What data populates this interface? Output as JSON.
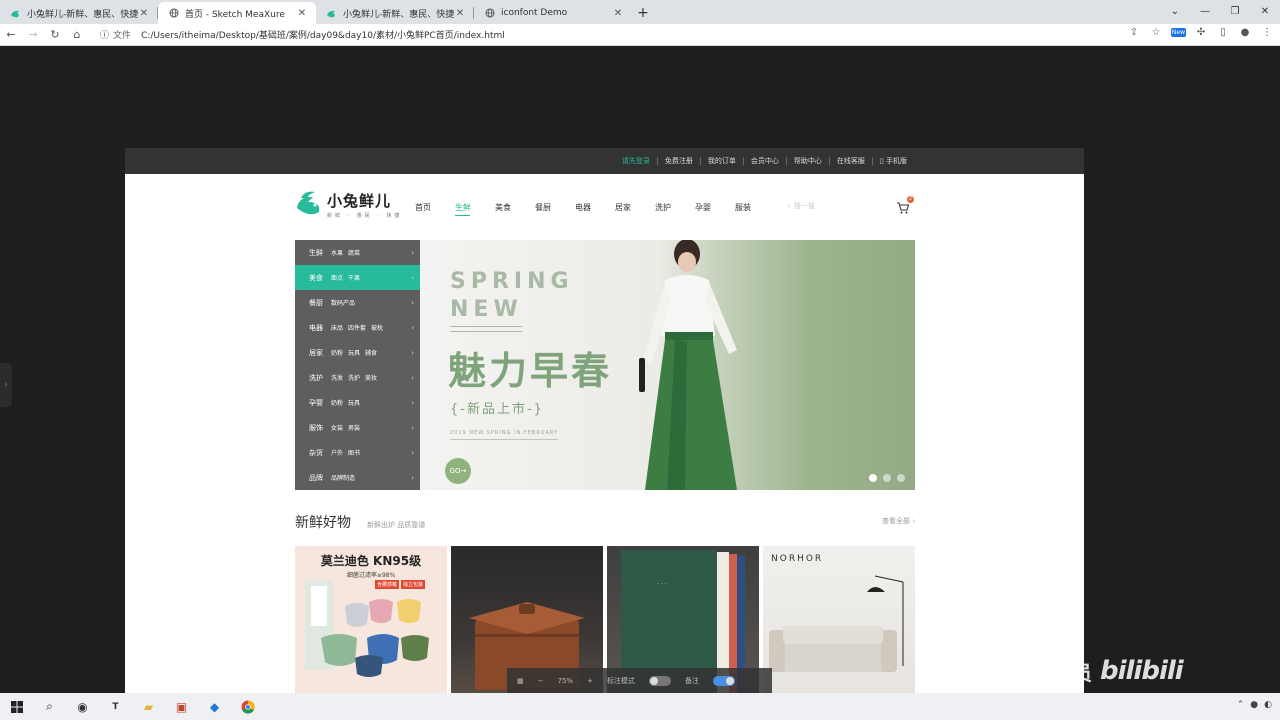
{
  "browser": {
    "tabs": [
      {
        "title": "小兔鲜儿-新鲜、惠民、快捷!",
        "favicon": "rabbit-logo-icon",
        "active": false
      },
      {
        "title": "首页 - Sketch MeaXure",
        "favicon": "globe-icon",
        "active": true
      },
      {
        "title": "小兔鲜儿-新鲜、惠民、快捷!",
        "favicon": "rabbit-logo-icon",
        "active": false
      },
      {
        "title": "iconfont Demo",
        "favicon": "globe-icon",
        "active": false
      }
    ],
    "address": {
      "protocol_label": "文件",
      "url": "C:/Users/itheima/Desktop/基础班/案例/day09&day10/素材/小兔鲜PC首页/index.html"
    },
    "new_badge": "New"
  },
  "site": {
    "topnav": [
      "请先登录",
      "免费注册",
      "我的订单",
      "会员中心",
      "帮助中心",
      "在线客服",
      "手机版"
    ],
    "logo": {
      "name": "小兔鲜儿",
      "sub": "新鲜 · 惠民 · 快捷"
    },
    "mainnav": [
      "首页",
      "生鲜",
      "美食",
      "餐厨",
      "电器",
      "居家",
      "洗护",
      "孕婴",
      "服装"
    ],
    "mainnav_active": 1,
    "search": {
      "placeholder": "搜一搜"
    },
    "cart": {
      "count": "2"
    },
    "categories": [
      {
        "name": "生鲜",
        "subs": [
          "水果",
          "蔬菜"
        ]
      },
      {
        "name": "美食",
        "subs": [
          "面点",
          "干果"
        ]
      },
      {
        "name": "餐厨",
        "subs": [
          "数码产品"
        ]
      },
      {
        "name": "电器",
        "subs": [
          "床品",
          "四件套",
          "被枕"
        ]
      },
      {
        "name": "居家",
        "subs": [
          "奶粉",
          "玩具",
          "辅食"
        ]
      },
      {
        "name": "洗护",
        "subs": [
          "洗发",
          "洗护",
          "美妆"
        ]
      },
      {
        "name": "孕婴",
        "subs": [
          "奶粉",
          "玩具"
        ]
      },
      {
        "name": "服饰",
        "subs": [
          "女装",
          "男装"
        ]
      },
      {
        "name": "杂货",
        "subs": [
          "户外",
          "图书"
        ]
      },
      {
        "name": "品牌",
        "subs": [
          "品牌制造"
        ]
      }
    ],
    "category_active": 1,
    "banner": {
      "line1": "SPRING",
      "line2": "NEW",
      "title": "魅力早春",
      "subtitle": "{-新品上市-}",
      "tag": "2019 NEW SPRING IN FEBRUARY",
      "go": "GO",
      "slide_count": 3,
      "slide_active": 0
    },
    "section": {
      "title": "新鲜好物",
      "subtitle": "新鲜出炉 品质靠谱",
      "view_all": "查看全部"
    },
    "products": [
      {
        "title": "莫兰迪色 KN95级",
        "sub": "细菌过滤率≥98%",
        "tags": [
          "含腰感戴",
          "独立包装"
        ]
      },
      {
        "title": ""
      },
      {
        "title": ""
      },
      {
        "brand": "NORHOR"
      }
    ]
  },
  "overlay": {
    "zoom": "75%",
    "mode_label": "标注模式",
    "notes_label": "备注",
    "watermark_text": "程序员",
    "watermark_logo": "bilibili"
  },
  "colors": {
    "brand": "#27ba9b",
    "topbar": "#333333",
    "menu": "#5e5e5e",
    "cart_badge": "#e26237"
  }
}
